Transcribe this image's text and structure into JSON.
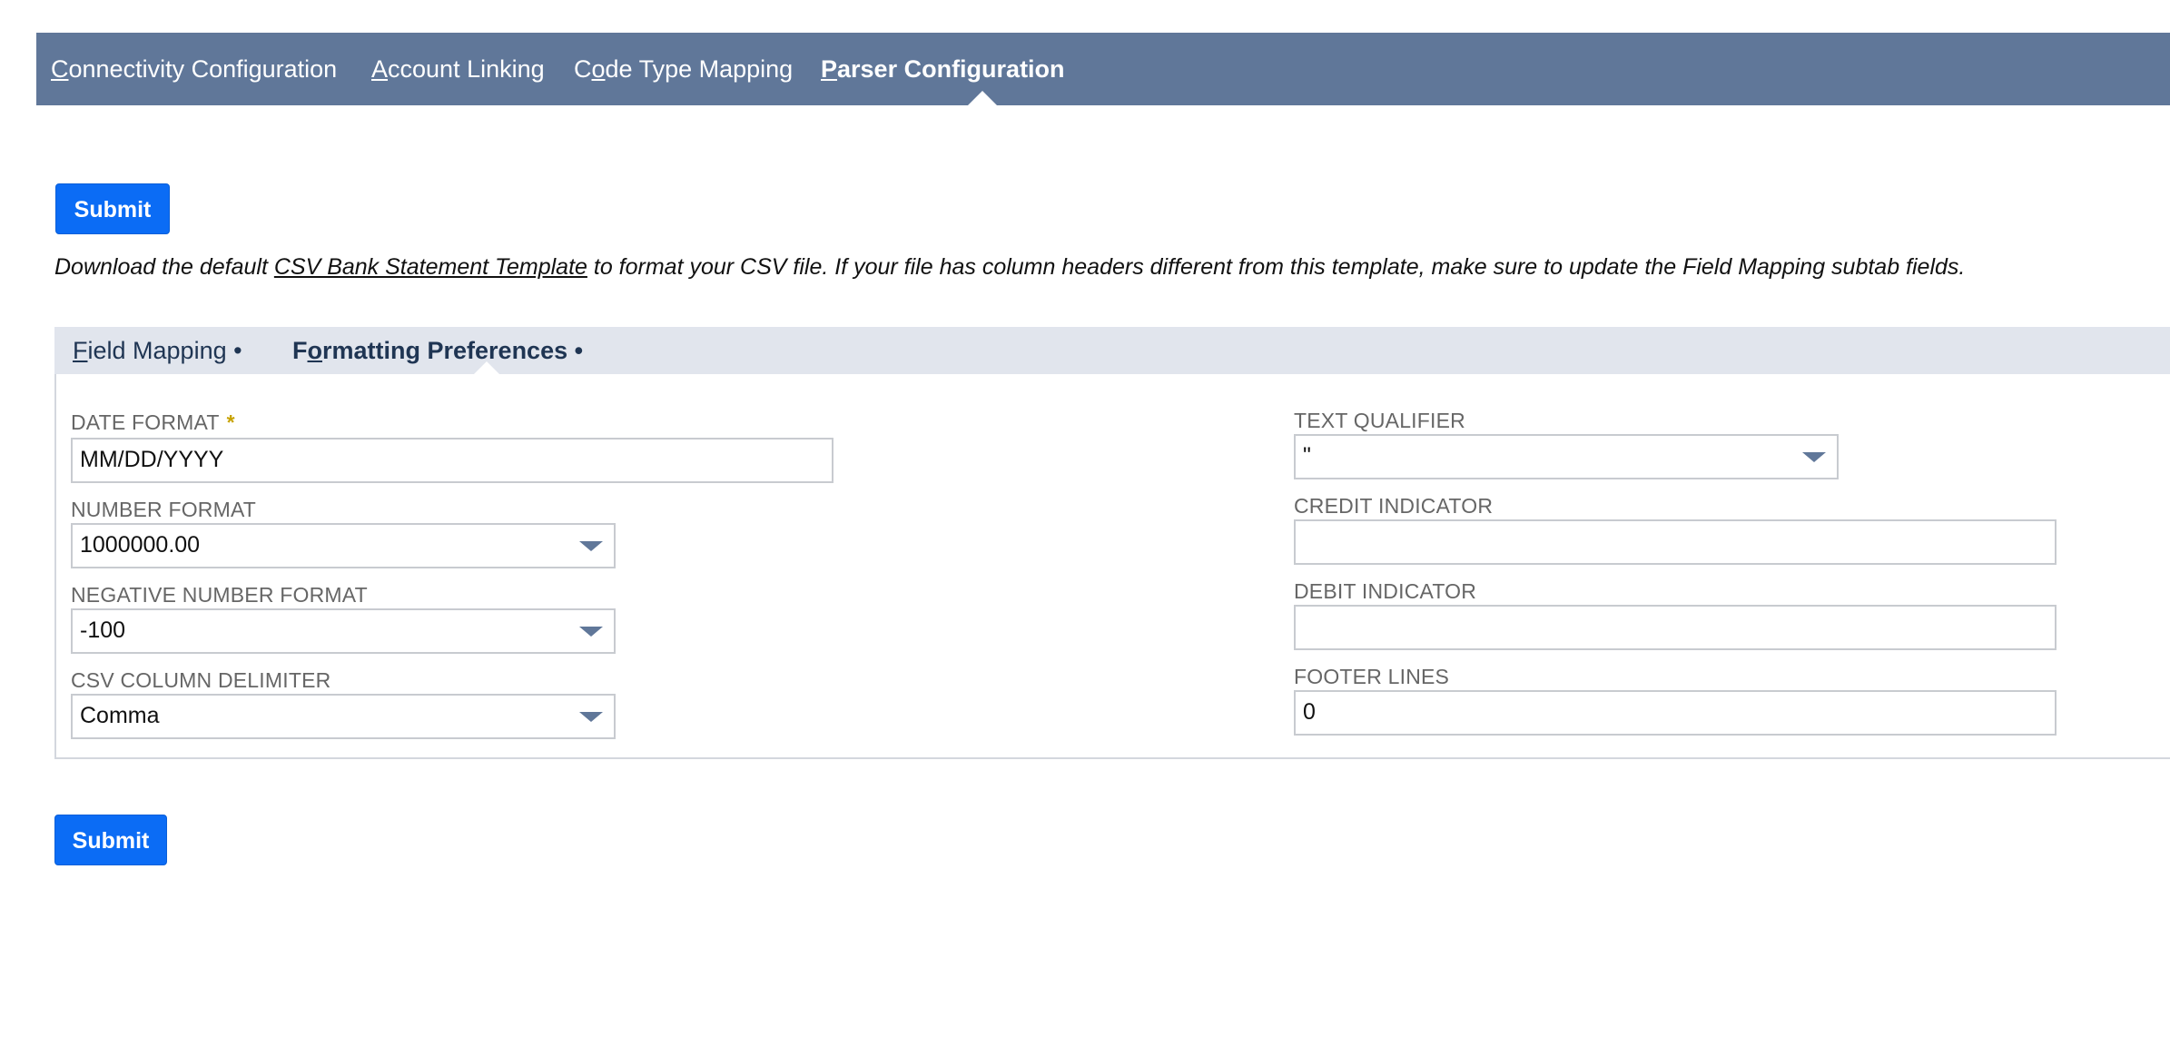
{
  "top_nav": {
    "tabs": [
      {
        "first": "C",
        "rest": "onnectivity Configuration"
      },
      {
        "first": "A",
        "rest": "ccount Linking"
      },
      {
        "pre": "C",
        "first": "o",
        "rest": "de Type Mapping"
      },
      {
        "first": "P",
        "rest": "arser Configuration"
      }
    ],
    "active_index": 3
  },
  "buttons": {
    "submit_label": "Submit"
  },
  "description": {
    "before": "Download the default ",
    "link": "CSV Bank Statement Template",
    "after": " to format your CSV file. If your file has column headers different from this template, make sure to update the Field Mapping subtab fields."
  },
  "subtabs": {
    "field_mapping": {
      "first": "F",
      "rest": "ield Mapping",
      "dot": "•"
    },
    "formatting_preferences": {
      "pre": "F",
      "first": "o",
      "rest": "rmatting Preferences",
      "dot": "•"
    },
    "active": "formatting_preferences"
  },
  "form": {
    "date_format": {
      "label": "DATE FORMAT",
      "required_mark": "*",
      "value": "MM/DD/YYYY"
    },
    "number_format": {
      "label": "NUMBER FORMAT",
      "value": "1000000.00"
    },
    "negative_number_format": {
      "label": "NEGATIVE NUMBER FORMAT",
      "value": "-100"
    },
    "csv_column_delimiter": {
      "label": "CSV COLUMN DELIMITER",
      "value": "Comma"
    },
    "text_qualifier": {
      "label": "TEXT QUALIFIER",
      "value": "\""
    },
    "credit_indicator": {
      "label": "CREDIT INDICATOR",
      "value": ""
    },
    "debit_indicator": {
      "label": "DEBIT INDICATOR",
      "value": ""
    },
    "footer_lines": {
      "label": "FOOTER LINES",
      "value": "0"
    }
  },
  "icons": {
    "dropdown": "chevron-down-icon"
  },
  "colors": {
    "nav_bg": "#607799",
    "button_bg": "#0b6cf5",
    "subtab_bg": "#e1e5ed",
    "required": "#c7a200"
  }
}
